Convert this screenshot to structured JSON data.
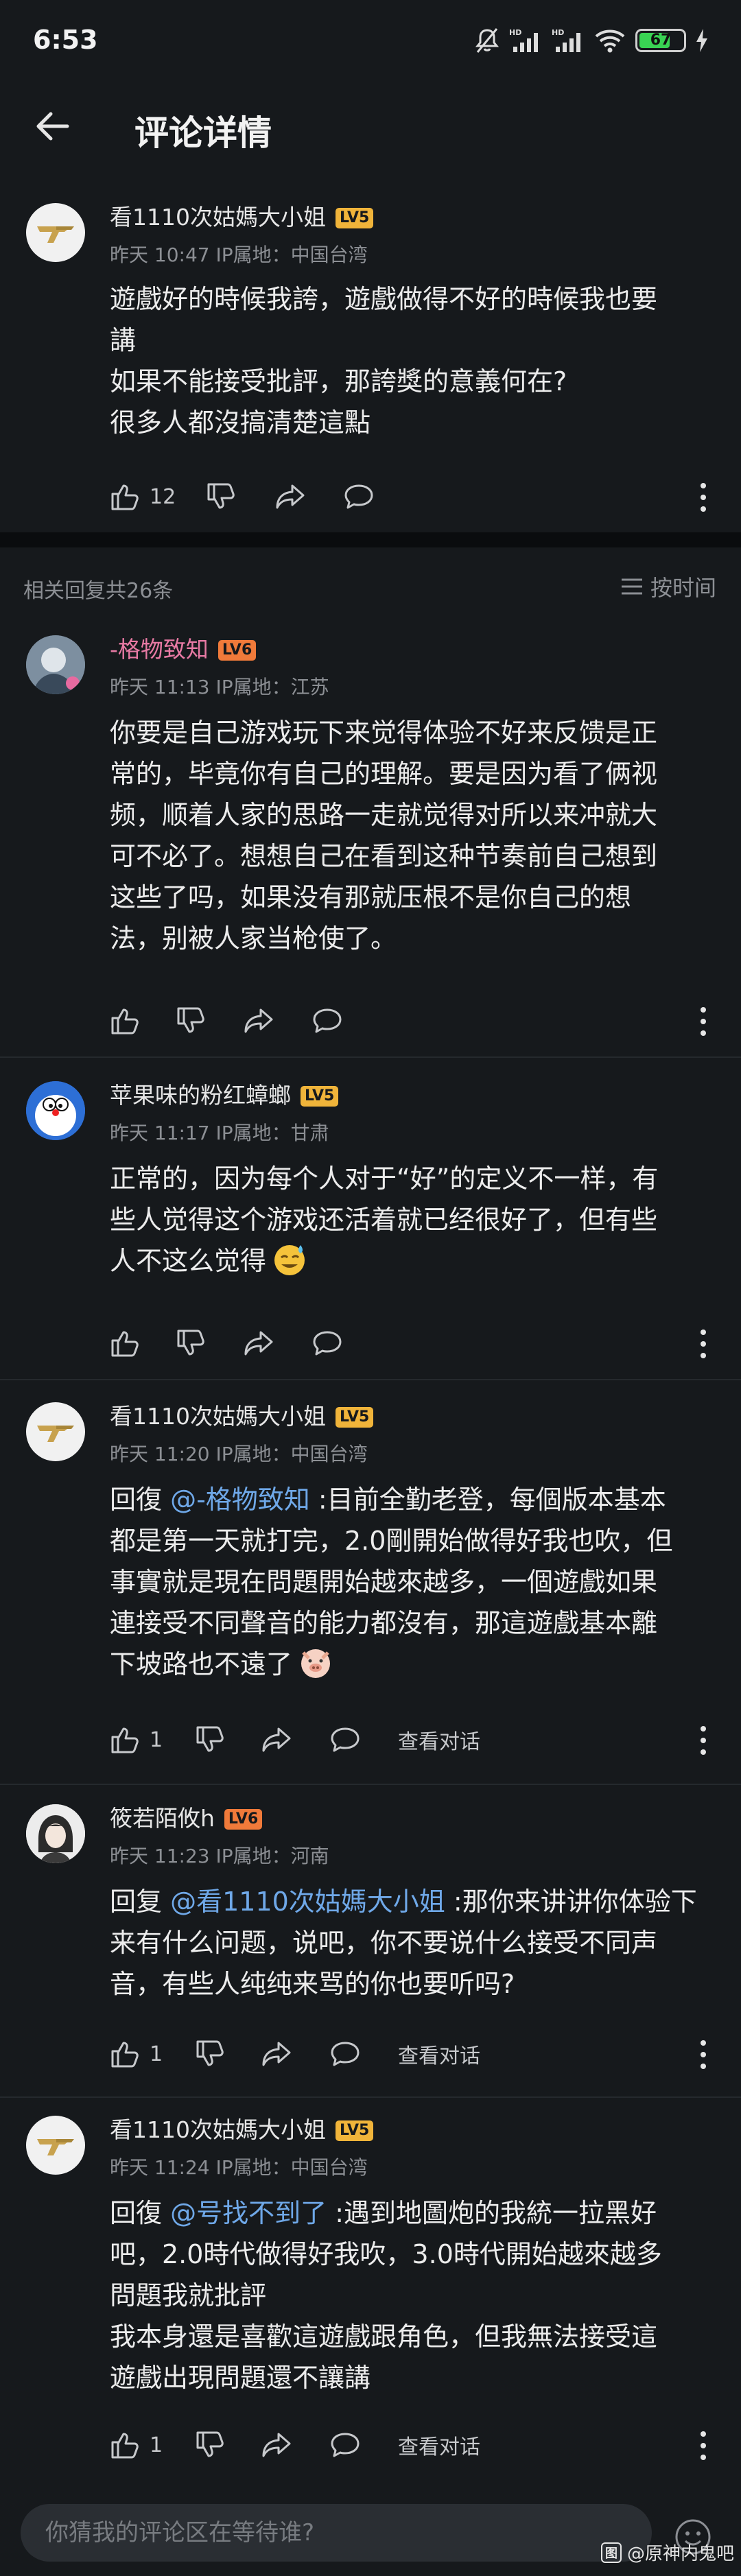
{
  "status_bar": {
    "time": "6:53",
    "battery": "67",
    "signal1_label": "HD",
    "signal2_label": "HD"
  },
  "header": {
    "title": "评论详情"
  },
  "main_comment": {
    "user": "看1110次姑媽大小姐",
    "level": "LV5",
    "meta": "昨天 10:47 IP属地：中国台湾",
    "lines": [
      "遊戲好的時候我誇，遊戲做得不好的時候我也要",
      "講",
      "如果不能接受批評，那誇獎的意義何在?",
      "很多人都沒搞清楚這點"
    ],
    "likes": "12"
  },
  "replies_bar": {
    "count": "相关回复共26条",
    "sort": "按时间"
  },
  "replies": [
    {
      "user": "-格物致知",
      "level": "LV6",
      "meta": "昨天 11:13 IP属地：江苏",
      "lines": [
        "你要是自己游戏玩下来觉得体验不好来反馈是正",
        "常的，毕竟你有自己的理解。要是因为看了俩视",
        "频，顺着人家的思路一走就觉得对所以来冲就大",
        "可不必了。想想自己在看到这种节奏前自己想到",
        "这些了吗，如果没有那就压根不是你自己的想",
        "法，别被人家当枪使了。"
      ]
    },
    {
      "user": "苹果味的粉红蟑螂",
      "level": "LV5",
      "meta": "昨天 11:17 IP属地：甘肃",
      "lines": [
        "正常的，因为每个人对于“好”的定义不一样，有",
        "些人觉得这个游戏还活着就已经很好了，但有些",
        "人不这么觉得"
      ]
    },
    {
      "user": "看1110次姑媽大小姐",
      "level": "LV5",
      "meta": "昨天 11:20 IP属地：中国台湾",
      "reply_prefix": "回復 ",
      "mention": "@-格物致知",
      "line1_rest": " :目前全勤老登，每個版本基本",
      "lines": [
        "都是第一天就打完，2.0剛開始做得好我也吹，但",
        "事實就是現在問題開始越來越多，一個遊戲如果",
        "連接受不同聲音的能力都沒有，那這遊戲基本離",
        "下坡路也不遠了"
      ],
      "likes": "1",
      "view_dialog": "查看对话"
    },
    {
      "user": "筱若陌攸h",
      "level": "LV6",
      "meta": "昨天 11:23 IP属地：河南",
      "reply_prefix": "回复 ",
      "mention": "@看1110次姑媽大小姐",
      "line1_rest": " :那你来讲讲你体验下",
      "lines": [
        "来有什么问题，说吧，你不要说什么接受不同声",
        "音，有些人纯纯来骂的你也要听吗?"
      ],
      "likes": "1",
      "view_dialog": "查看对话"
    },
    {
      "user": "看1110次姑媽大小姐",
      "level": "LV5",
      "meta": "昨天 11:24 IP属地：中国台湾",
      "reply_prefix": "回復 ",
      "mention": "@号找不到了",
      "line1_rest": " :遇到地圖炮的我統一拉黑好",
      "lines": [
        "吧，2.0時代做得好我吹，3.0時代開始越來越多",
        "問題我就批評",
        "我本身還是喜歡這遊戲跟角色，但我無法接受這",
        "遊戲出現問題還不讓講"
      ],
      "likes": "1",
      "view_dialog": "查看对话"
    }
  ],
  "input": {
    "placeholder": "你猜我的评论区在等待谁?"
  },
  "watermark": {
    "icon_text": "图",
    "text": "@原神内鬼吧"
  },
  "colors": {
    "lv5": "#f0b43a",
    "lv6": "#f07a3a",
    "mention": "#6fa8e8",
    "username_pink": "#e87aa4"
  }
}
